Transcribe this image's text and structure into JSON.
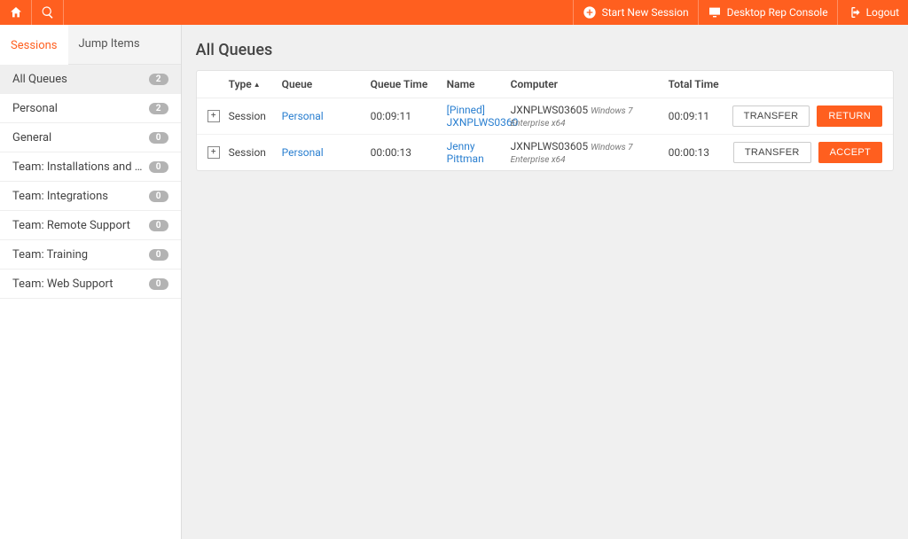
{
  "topbar": {
    "start_session": "Start New Session",
    "desktop_console": "Desktop Rep Console",
    "logout": "Logout"
  },
  "tabs": {
    "sessions": "Sessions",
    "jump_items": "Jump Items"
  },
  "sidebar": {
    "items": [
      {
        "label": "All Queues",
        "count": "2",
        "selected": true
      },
      {
        "label": "Personal",
        "count": "2",
        "selected": false
      },
      {
        "label": "General",
        "count": "0",
        "selected": false
      },
      {
        "label": "Team: Installations and Upg...",
        "count": "0",
        "selected": false
      },
      {
        "label": "Team: Integrations",
        "count": "0",
        "selected": false
      },
      {
        "label": "Team: Remote Support",
        "count": "0",
        "selected": false
      },
      {
        "label": "Team: Training",
        "count": "0",
        "selected": false
      },
      {
        "label": "Team: Web Support",
        "count": "0",
        "selected": false
      }
    ]
  },
  "main": {
    "title": "All Queues",
    "columns": {
      "type": "Type",
      "queue": "Queue",
      "queue_time": "Queue Time",
      "name": "Name",
      "computer": "Computer",
      "total_time": "Total Time"
    },
    "rows": [
      {
        "type": "Session",
        "queue": "Personal",
        "queue_time": "00:09:11",
        "name_line1": "[Pinned]",
        "name_line2": "JXNPLWS0360",
        "computer": "JXNPLWS03605",
        "os": "Windows 7 Enterprise x64",
        "total_time": "00:09:11",
        "action1": "TRANSFER",
        "action2": "RETURN"
      },
      {
        "type": "Session",
        "queue": "Personal",
        "queue_time": "00:00:13",
        "name_line1": "Jenny",
        "name_line2": "Pittman",
        "computer": "JXNPLWS03605",
        "os": "Windows 7 Enterprise x64",
        "total_time": "00:00:13",
        "action1": "TRANSFER",
        "action2": "ACCEPT"
      }
    ]
  }
}
